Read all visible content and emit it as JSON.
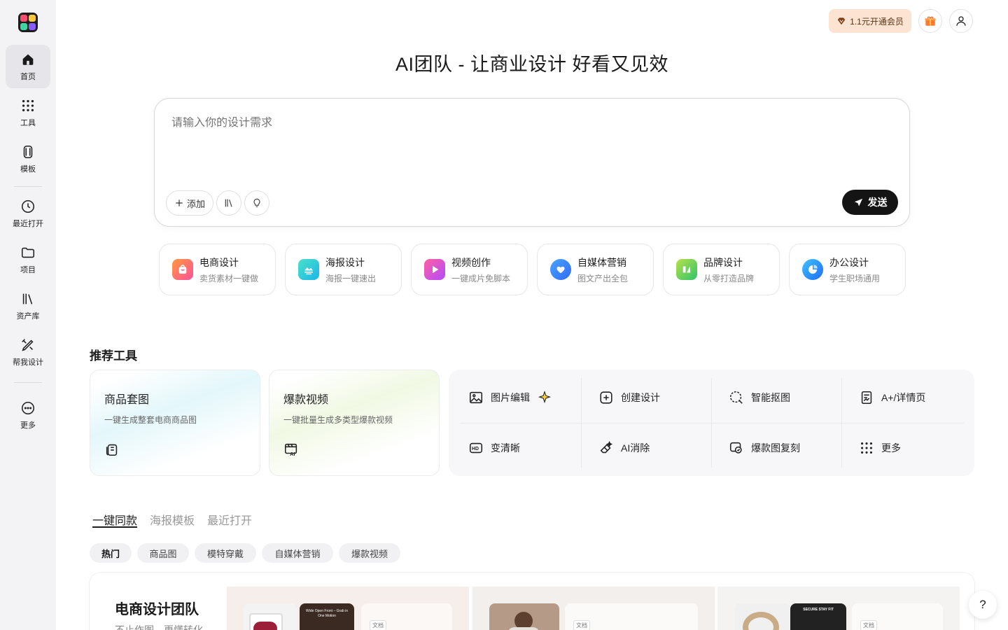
{
  "sidebar": {
    "items": [
      {
        "label": "首页",
        "icon": "home-icon"
      },
      {
        "label": "工具",
        "icon": "grid-icon"
      },
      {
        "label": "模板",
        "icon": "template-icon"
      },
      {
        "label": "最近打开",
        "icon": "clock-icon"
      },
      {
        "label": "项目",
        "icon": "folder-icon"
      },
      {
        "label": "资产库",
        "icon": "library-icon"
      },
      {
        "label": "帮我设计",
        "icon": "design-tools-icon"
      },
      {
        "label": "更多",
        "icon": "more-icon"
      }
    ]
  },
  "header": {
    "vip_label": "1.1元开通会员",
    "gift_icon": "gift-icon",
    "user_icon": "user-icon"
  },
  "hero": {
    "title": "AI团队 - 让商业设计 好看又见效",
    "placeholder": "请输入你的设计需求",
    "add_label": "添加",
    "send_label": "发送"
  },
  "categories": [
    {
      "title": "电商设计",
      "sub": "卖货素材一键做",
      "color": "#ff5a8a"
    },
    {
      "title": "海报设计",
      "sub": "海报一键速出",
      "color": "#24c6d6"
    },
    {
      "title": "视频创作",
      "sub": "一键成片免脚本",
      "color": "#d94bd0"
    },
    {
      "title": "自媒体营销",
      "sub": "图文产出全包",
      "color": "#2f7dff"
    },
    {
      "title": "品牌设计",
      "sub": "从零打造品牌",
      "color": "#2fc46a"
    },
    {
      "title": "办公设计",
      "sub": "学生职场通用",
      "color": "#1e8cff"
    }
  ],
  "tools": {
    "title": "推荐工具",
    "big": [
      {
        "title": "商品套图",
        "sub": "一键生成整套电商商品图"
      },
      {
        "title": "爆款视频",
        "sub": "一键批量生成多类型爆款视频"
      }
    ],
    "grid": [
      {
        "label": "图片编辑",
        "icon": "image-edit-icon"
      },
      {
        "label": "创建设计",
        "icon": "plus-square-icon"
      },
      {
        "label": "智能抠图",
        "icon": "cutout-icon"
      },
      {
        "label": "A+/详情页",
        "icon": "detail-page-icon"
      },
      {
        "label": "变清晰",
        "icon": "hd-icon"
      },
      {
        "label": "AI消除",
        "icon": "eraser-icon"
      },
      {
        "label": "爆款图复刻",
        "icon": "replicate-icon"
      },
      {
        "label": "更多",
        "icon": "dots-grid-icon"
      }
    ]
  },
  "tabs": [
    "一键同款",
    "海报模板",
    "最近打开"
  ],
  "chips": [
    "热门",
    "商品图",
    "模特穿戴",
    "自媒体营销",
    "爆款视频"
  ],
  "showcase": {
    "title": "电商设计团队",
    "sub": "不止作图，更懂转化",
    "tag": "文档",
    "thumb1_caption": "Wide Open Front – Grab in One Motion",
    "thumb3_caption": "SECURE STAY FIT"
  },
  "help_label": "?"
}
